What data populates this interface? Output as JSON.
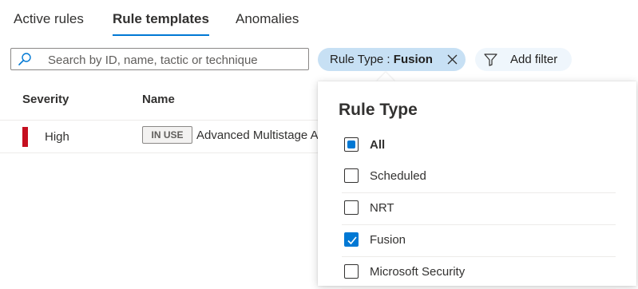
{
  "tabs": [
    {
      "label": "Active rules"
    },
    {
      "label": "Rule templates"
    },
    {
      "label": "Anomalies"
    }
  ],
  "search": {
    "placeholder": "Search by ID, name, tactic or technique"
  },
  "filter_pill": {
    "key": "Rule Type : ",
    "value": "Fusion"
  },
  "add_filter": {
    "label": "Add filter"
  },
  "grid": {
    "headers": {
      "severity": "Severity",
      "name": "Name"
    },
    "rows": [
      {
        "severity": "High",
        "badge": "IN USE",
        "name": "Advanced Multistage Attack Detection"
      }
    ]
  },
  "panel": {
    "title": "Rule Type",
    "options": [
      {
        "label": "All",
        "state": "indeterminate"
      },
      {
        "label": "Scheduled",
        "state": "unchecked"
      },
      {
        "label": "NRT",
        "state": "unchecked"
      },
      {
        "label": "Fusion",
        "state": "checked"
      },
      {
        "label": "Microsoft Security",
        "state": "unchecked"
      }
    ]
  },
  "colors": {
    "accent": "#0078d4",
    "severity_high": "#c50f1f",
    "pill_bg": "#c7e0f4"
  }
}
